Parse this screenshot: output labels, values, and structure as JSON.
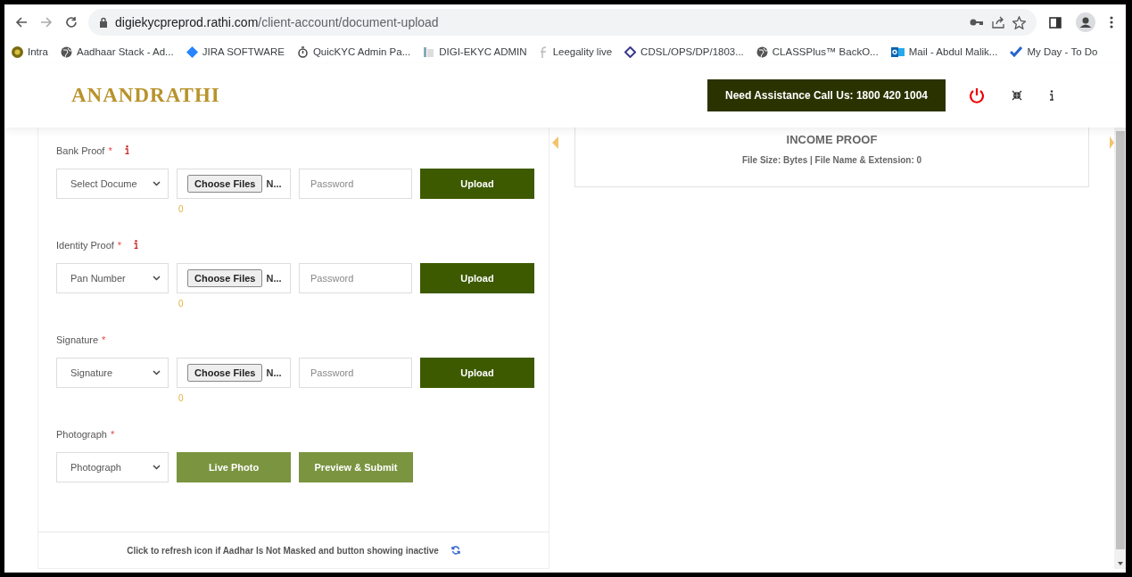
{
  "browser": {
    "url_host": "digiekycpreprod.rathi.com",
    "url_path": "/client-account/document-upload",
    "bookmarks": [
      {
        "label": "Intra"
      },
      {
        "label": "Aadhaar Stack - Ad..."
      },
      {
        "label": "JIRA SOFTWARE"
      },
      {
        "label": "QuicKYC Admin Pa..."
      },
      {
        "label": "DIGI-EKYC ADMIN"
      },
      {
        "label": "Leegality live"
      },
      {
        "label": "CDSL/OPS/DP/1803..."
      },
      {
        "label": "CLASSPlus™ BackO..."
      },
      {
        "label": "Mail - Abdul Malik..."
      },
      {
        "label": "My Day - To Do"
      }
    ]
  },
  "header": {
    "logo": "ANANDRATHI",
    "assistance": "Need Assistance Call Us: 1800 420 1004"
  },
  "sections": [
    {
      "kind": "upload",
      "label": "Bank Proof",
      "required_mark": "*",
      "info": true,
      "select": "Select Docume",
      "file_button": "Choose Files",
      "file_name": "N...",
      "password_placeholder": "Password",
      "count": "0",
      "button": "Upload"
    },
    {
      "kind": "upload",
      "label": "Identity Proof",
      "required_mark": "*",
      "info": true,
      "select": "Pan Number",
      "file_button": "Choose Files",
      "file_name": "N...",
      "password_placeholder": "Password",
      "count": "0",
      "button": "Upload"
    },
    {
      "kind": "upload",
      "label": "Signature",
      "required_mark": "*",
      "info": false,
      "select": "Signature",
      "file_button": "Choose Files",
      "file_name": "N...",
      "password_placeholder": "Password",
      "count": "0",
      "button": "Upload"
    },
    {
      "kind": "photo",
      "label": "Photograph",
      "required_mark": "*",
      "info": false,
      "select": "Photograph",
      "buttons": [
        "Live Photo",
        "Preview & Submit"
      ]
    }
  ],
  "note": "Click to refresh icon if Aadhar Is Not Masked and button showing inactive",
  "income": {
    "title": "INCOME PROOF",
    "detail": "File Size: Bytes | File Name & Extension: 0"
  }
}
